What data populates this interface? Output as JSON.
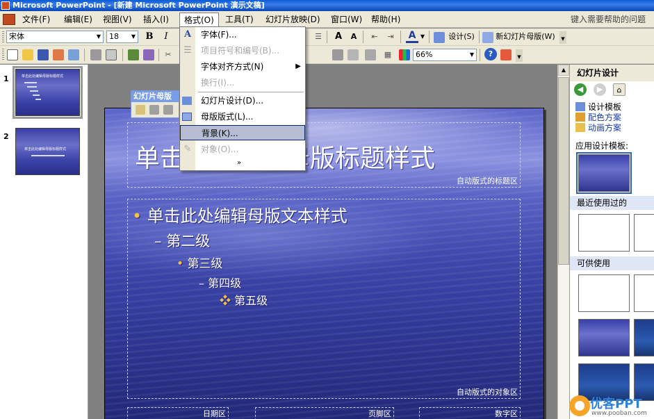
{
  "window": {
    "title": "Microsoft PowerPoint - [新建 Microsoft PowerPoint 演示文稿]"
  },
  "menubar": {
    "items": [
      "文件(F)",
      "编辑(E)",
      "视图(V)",
      "插入(I)",
      "格式(O)",
      "工具(T)",
      "幻灯片放映(D)",
      "窗口(W)",
      "帮助(H)"
    ],
    "help_placeholder": "键入需要帮助的问题"
  },
  "toolbar1": {
    "font": "宋体",
    "font_size": "18",
    "bold": "B",
    "italic": "I",
    "design_button": "设计(S)",
    "new_master_button": "新幻灯片母版(W)"
  },
  "toolbar2": {
    "zoom": "66%"
  },
  "format_menu": {
    "items": [
      {
        "label": "字体(F)...",
        "disabled": false
      },
      {
        "label": "项目符号和编号(B)...",
        "disabled": true
      },
      {
        "label": "字体对齐方式(N)",
        "disabled": false,
        "submenu": true
      },
      {
        "label": "换行(I)...",
        "disabled": true
      },
      {
        "label": "幻灯片设计(D)...",
        "disabled": false
      },
      {
        "label": "母版版式(L)...",
        "disabled": false
      },
      {
        "label": "背景(K)...",
        "disabled": false,
        "highlighted": true
      },
      {
        "label": "对象(O)...",
        "disabled": true
      }
    ],
    "expand_glyph": "»"
  },
  "master_toolbar": {
    "title": "幻灯片母版"
  },
  "slides_pane": {
    "slides": [
      {
        "number": "1",
        "title": "单击此处编辑母版标题样式"
      },
      {
        "number": "2",
        "title": "单击此处编辑母版标题样式"
      }
    ]
  },
  "slide": {
    "title": "单击此处编辑母版标题样式",
    "title_area_label": "自动版式的标题区",
    "body_levels": [
      {
        "bullet": "•",
        "text": "单击此处编辑母版文本样式"
      },
      {
        "bullet": "–",
        "text": "第二级"
      },
      {
        "bullet": "•",
        "text": "第三级"
      },
      {
        "bullet": "–",
        "text": "第四级"
      },
      {
        "bullet": "❖",
        "text": "第五级"
      }
    ],
    "object_area_label": "自动版式的对象区",
    "date_area": "日期区",
    "footer_area": "页脚区",
    "number_area": "数字区"
  },
  "task_pane": {
    "title": "幻灯片设计",
    "links": [
      "设计模板",
      "配色方案",
      "动画方案"
    ],
    "apply_label": "应用设计模板:",
    "recent_section": "最近使用过的",
    "available_section": "可供使用"
  },
  "watermark": {
    "brand": "优客PPT",
    "site": "www.pooban.com"
  },
  "colors": {
    "menu_bg": "#ece9d8",
    "title_bar": "#0a5bd6",
    "highlight": "#b6bdd2",
    "bullet": "#f2c14a",
    "slide_blue": "#3d46aa"
  }
}
